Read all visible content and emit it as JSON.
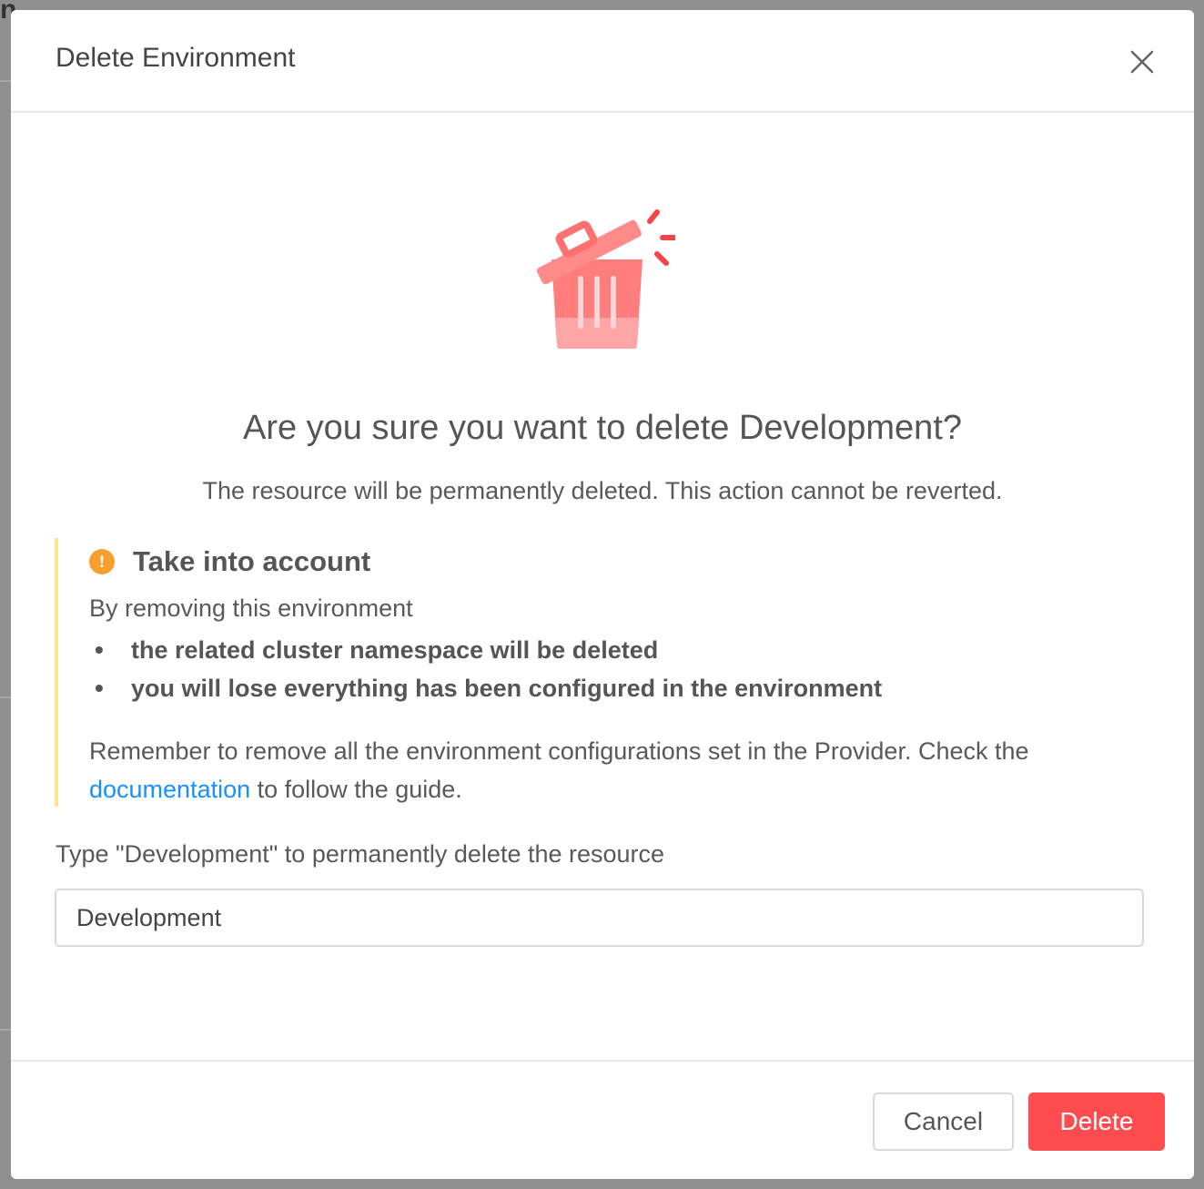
{
  "dialog": {
    "title": "Delete Environment",
    "close_icon": "close-icon"
  },
  "illustration": {
    "icon": "trash-can-open-icon",
    "colors": {
      "body": "#ff7d7d",
      "lid": "#ff8a8a",
      "base": "#ffa5a5",
      "sparks": "#f5434a"
    }
  },
  "confirmation": {
    "question": "Are you sure you want to delete Development?",
    "subtitle": "The resource will be permanently deleted. This action cannot be reverted."
  },
  "callout": {
    "icon": "warning-icon",
    "title": "Take into account",
    "intro": "By removing this environment",
    "bullets": [
      "the related cluster namespace will be deleted",
      "you will lose everything has been configured in the environment"
    ],
    "remember_before": "Remember to remove all the environment configurations set in the Provider. Check the",
    "link_text": "documentation",
    "remember_after": "to follow the guide.",
    "accent_color": "#ffe58f",
    "icon_color": "#fa9e2d"
  },
  "type_confirm": {
    "label": "Type \"Development\" to permanently delete the resource",
    "value": "Development"
  },
  "footer": {
    "cancel_label": "Cancel",
    "delete_label": "Delete",
    "delete_color": "#ff4d4f"
  }
}
